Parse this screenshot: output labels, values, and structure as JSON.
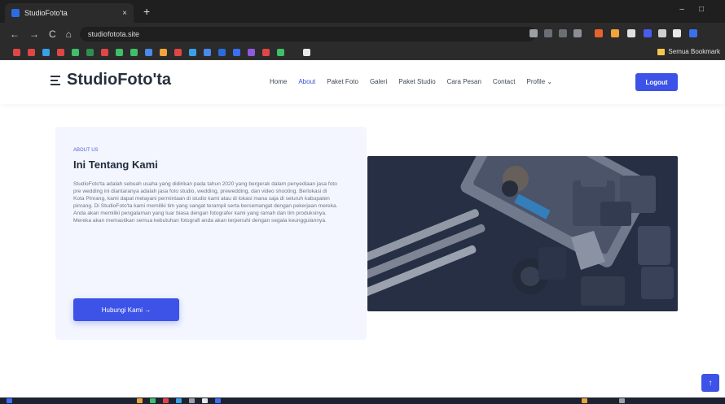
{
  "browser": {
    "tab_title": "StudioFoto'ta",
    "tab_close": "×",
    "new_tab": "+",
    "window_controls": "–□",
    "back": "←",
    "forward": "→",
    "reload": "C",
    "home": "⌂",
    "url": "studiofotota.site",
    "all_bookmarks": "Semua Bookmark"
  },
  "site": {
    "brand": "StudioFoto'ta",
    "menu": [
      {
        "label": "Home"
      },
      {
        "label": "About"
      },
      {
        "label": "Paket Foto"
      },
      {
        "label": "Galeri"
      },
      {
        "label": "Paket Studio"
      },
      {
        "label": "Cara Pesan"
      },
      {
        "label": "Contact"
      },
      {
        "label": "Profile ⌄"
      }
    ],
    "active_menu": "About",
    "logout": "Logout"
  },
  "about": {
    "eyebrow": "ABOUT US",
    "heading": "Ini Tentang Kami",
    "paragraph": "StudioFoto'ta adalah sebuah usaha yang didirikan pada tahun 2020 yang bergerak dalam penyediaan jasa foto pre wedding ini diantaranya adalah jasa foto studio, wedding, prewedding, dan video shooting. Berlokasi di Kota Pinrang, kami dapat melayani permintaan di studio kami atau di lokasi mana saja di seluruh kabupaten pinrang. Di StudioFoto'ta kami memiliki tim yang sangat terampil serta bersemangat dengan pekerjaan mereka. Anda akan memiliki pengalaman yang luar biasa dengan fotografer kami yang ramah dan tim produksinya. Mereka akan memastikan semua kebutuhan fotografi anda akan terpenuhi dengan segala keunggulannya.",
    "cta": "Hubungi Kami →"
  },
  "fab": "↑",
  "colors": {
    "accent": "#3d52e6",
    "card_bg": "#f3f6fe",
    "heading": "#1f2a3a"
  }
}
